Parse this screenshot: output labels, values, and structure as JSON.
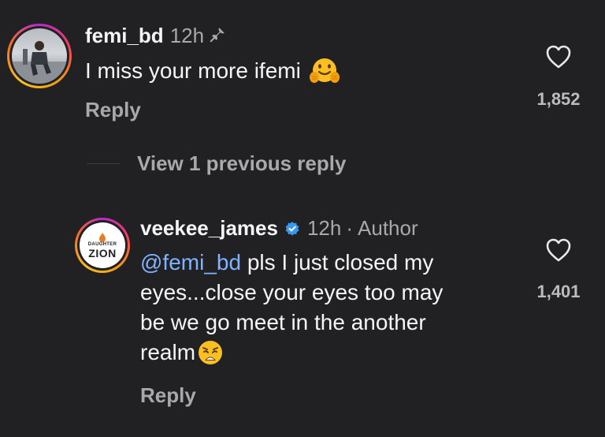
{
  "comments": [
    {
      "username": "femi_bd",
      "time": "12h",
      "text": "I miss your more ifemi",
      "emoji": "hugging-face",
      "reply_label": "Reply",
      "likes": "1,852"
    }
  ],
  "view_replies_label": "View 1 previous reply",
  "replies": [
    {
      "username": "veekee_james",
      "time": "12h",
      "separator": "·",
      "author_label": "Author",
      "mention": "@femi_bd",
      "line1_rest": " pls I just closed my",
      "line2": "eyes...close your eyes too may",
      "line3": "be we go meet in the another",
      "line4": "realm",
      "emoji": "weary-face",
      "reply_label": "Reply",
      "likes": "1,401",
      "avatar_logo_top": "DAUGHTER",
      "avatar_logo_bottom": "ZION"
    }
  ],
  "colors": {
    "background": "#212124",
    "mention": "#7fb3ff",
    "verified": "#3897f0"
  }
}
